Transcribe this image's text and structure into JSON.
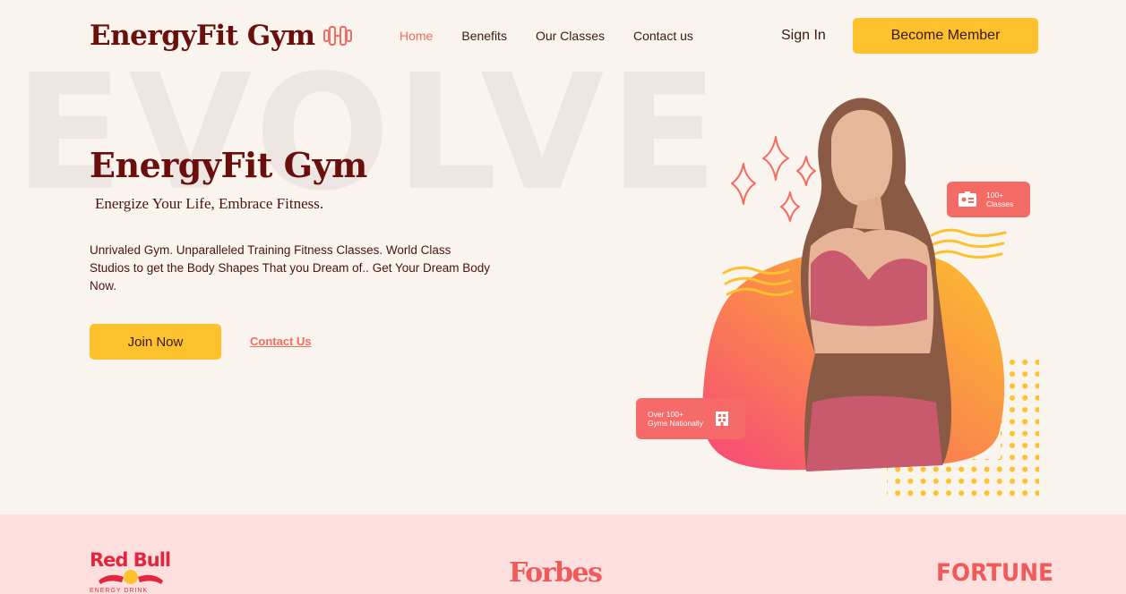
{
  "background_word": "EVOLVE",
  "header": {
    "logo_text": "EnergyFit Gym",
    "logo_icon": "dumbbell-icon",
    "nav": [
      {
        "label": "Home",
        "active": true
      },
      {
        "label": "Benefits",
        "active": false
      },
      {
        "label": "Our Classes",
        "active": false
      },
      {
        "label": "Contact us",
        "active": false
      }
    ],
    "sign_in": "Sign In",
    "become_member": "Become Member"
  },
  "hero": {
    "title": "EnergyFit Gym",
    "tagline": "Energize Your Life, Embrace Fitness.",
    "description": "Unrivaled Gym. Unparalleled Training Fitness Classes. World Class Studios to get the Body Shapes That you Dream of.. Get Your Dream Body Now.",
    "join_button": "Join Now",
    "contact_link": "Contact Us"
  },
  "badges": {
    "classes_line1": "100+",
    "classes_line2": "Classes",
    "classes_icon": "id-card-icon",
    "gyms_line1": "Over 100+",
    "gyms_line2": "Gyms Nationally",
    "gyms_icon": "building-icon"
  },
  "partners": {
    "redbull": "Red Bull",
    "redbull_sub": "ENERGY DRINK",
    "forbes": "Forbes",
    "fortune": "FORTUNE"
  },
  "colors": {
    "background": "#f9f4ed",
    "brand_dark": "#6b0f0c",
    "accent_yellow": "#fcc12c",
    "accent_coral": "#f46b5f",
    "partners_bg": "#fde0de"
  }
}
